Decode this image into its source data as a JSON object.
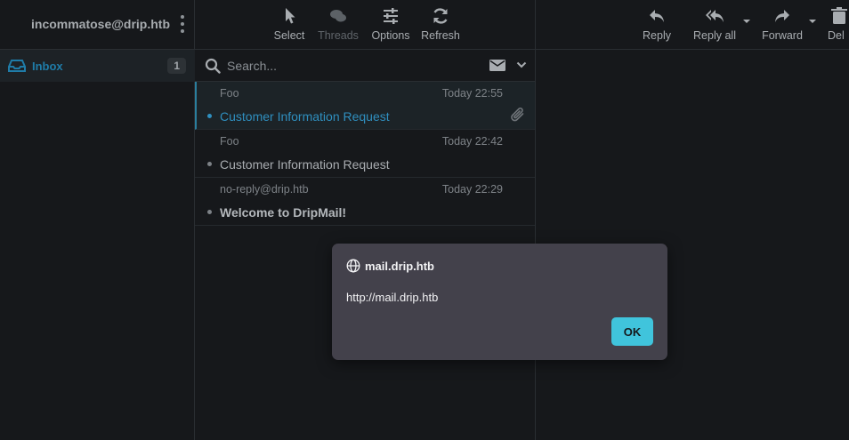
{
  "account": {
    "email": "incommatose@drip.htb"
  },
  "folders": [
    {
      "label": "Inbox",
      "count": "1"
    }
  ],
  "toolbar": {
    "select": "Select",
    "threads": "Threads",
    "options": "Options",
    "refresh": "Refresh"
  },
  "search": {
    "placeholder": "Search..."
  },
  "messages": [
    {
      "from": "Foo",
      "date": "Today 22:55",
      "subject": "Customer Information Request"
    },
    {
      "from": "Foo",
      "date": "Today 22:42",
      "subject": "Customer Information Request"
    },
    {
      "from": "no-reply@drip.htb",
      "date": "Today 22:29",
      "subject": "Welcome to DripMail!"
    }
  ],
  "reader_toolbar": {
    "reply": "Reply",
    "reply_all": "Reply all",
    "forward": "Forward",
    "delete": "Del"
  },
  "dialog": {
    "title": "mail.drip.htb",
    "message": "http://mail.drip.htb",
    "ok": "OK"
  }
}
